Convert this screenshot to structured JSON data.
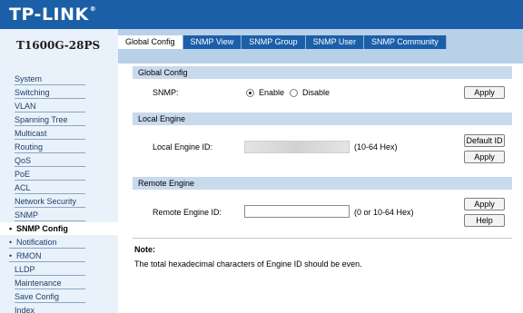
{
  "brand": {
    "name": "TP-LINK",
    "reg": "®"
  },
  "model": "T1600G-28PS",
  "tabs": [
    "Global Config",
    "SNMP View",
    "SNMP Group",
    "SNMP User",
    "SNMP Community"
  ],
  "active_tab": "Global Config",
  "sidebar": {
    "items": [
      "System",
      "Switching",
      "VLAN",
      "Spanning Tree",
      "Multicast",
      "Routing",
      "QoS",
      "PoE",
      "ACL",
      "Network Security",
      "SNMP"
    ],
    "sub_items": [
      "SNMP Config",
      "Notification",
      "RMON"
    ],
    "active_sub": "SNMP Config",
    "bottom_items": [
      "LLDP",
      "Maintenance",
      "Save Config",
      "Index"
    ]
  },
  "global_config": {
    "title": "Global Config",
    "snmp_label": "SNMP:",
    "enable_label": "Enable",
    "disable_label": "Disable",
    "selected": "Enable",
    "apply": "Apply"
  },
  "local_engine": {
    "title": "Local Engine",
    "id_label": "Local Engine ID:",
    "hint": "(10-64 Hex)",
    "default_id": "Default ID",
    "apply": "Apply"
  },
  "remote_engine": {
    "title": "Remote Engine",
    "id_label": "Remote Engine ID:",
    "hint": "(0 or 10-64 Hex)",
    "apply": "Apply",
    "help": "Help"
  },
  "note": {
    "title": "Note:",
    "text": "The total hexadecimal characters of Engine ID should be even."
  }
}
